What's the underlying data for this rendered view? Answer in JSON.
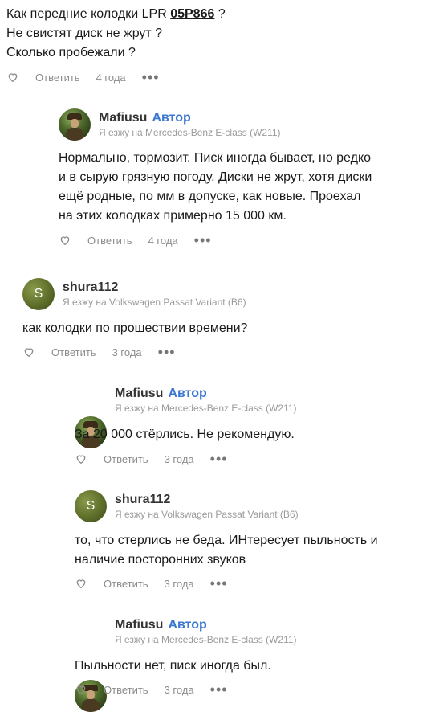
{
  "question": {
    "line1_prefix": "Как передние колодки LPR ",
    "part_number": "05P866",
    "line1_suffix": " ?",
    "line2": "Не свистят диск не жрут ?",
    "line3": "Сколько пробежали ?",
    "reply_label": "Ответить",
    "time": "4 года",
    "more": "•••"
  },
  "comments": [
    {
      "author": "Mafiusu",
      "badge": "Автор",
      "car": "Я езжу на Mercedes-Benz E-class (W211)",
      "lines": [
        "Нормально, тормозит. Писк иногда бывает, но редко",
        "и в сырую грязную погоду. Диски не жрут, хотя диски",
        "ещё родные, по мм в допуске, как новые. Проехал",
        "на этих колодках примерно 15 000 км."
      ],
      "reply_label": "Ответить",
      "time": "4 года",
      "more": "•••"
    },
    {
      "author": "shura112",
      "avatar_letter": "S",
      "car": "Я езжу на Volkswagen Passat Variant (B6)",
      "lines": [
        "как колодки по прошествии времени?"
      ],
      "reply_label": "Ответить",
      "time": "3 года",
      "more": "•••"
    },
    {
      "author": "Mafiusu",
      "badge": "Автор",
      "car": "Я езжу на Mercedes-Benz E-class (W211)",
      "lines": [
        "За 20 000 стёрлись. Не рекомендую."
      ],
      "reply_label": "Ответить",
      "time": "3 года",
      "more": "•••"
    },
    {
      "author": "shura112",
      "avatar_letter": "S",
      "car": "Я езжу на Volkswagen Passat Variant (B6)",
      "lines": [
        "то, что стерлись не беда. ИНтересует пыльность и",
        "наличие посторонних звуков"
      ],
      "reply_label": "Ответить",
      "time": "3 года",
      "more": "•••"
    },
    {
      "author": "Mafiusu",
      "badge": "Автор",
      "car": "Я езжу на Mercedes-Benz E-class (W211)",
      "lines": [
        "Пыльности нет, писк иногда был."
      ],
      "reply_label": "Ответить",
      "time": "3 года",
      "more": "•••"
    }
  ],
  "colors": {
    "author_badge": "#3a77d1",
    "meta_grey": "#8c8c8c"
  }
}
